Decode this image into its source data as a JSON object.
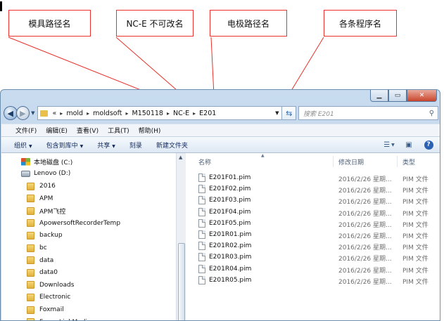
{
  "callouts": {
    "mold_path": "模具路径名",
    "nce_fixed": "NC-E 不可改名",
    "electrode_path": "电极路径名",
    "program_names": "各条程序名"
  },
  "address": {
    "prefix": "«",
    "crumbs": [
      "mold",
      "moldsoft",
      "M150118",
      "NC-E",
      "E201"
    ]
  },
  "search": {
    "placeholder": "搜索 E201",
    "icon": "search-icon"
  },
  "window_buttons": {
    "minimize": "minimize-icon",
    "maximize": "maximize-icon",
    "close": "close-icon"
  },
  "menu": {
    "file": "文件(F)",
    "edit": "编辑(E)",
    "view": "查看(V)",
    "tools": "工具(T)",
    "help": "帮助(H)"
  },
  "toolbar": {
    "organize": "组织",
    "include_library": "包含到库中",
    "share": "共享",
    "burn": "刻录",
    "new_folder": "新建文件夹"
  },
  "nav_tree": {
    "drive_c": "本地磁盘 (C:)",
    "drive_d": "Lenovo (D:)",
    "folders": [
      "2016",
      "APM",
      "APM飞控",
      "ApowersoftRecorderTemp",
      "backup",
      "bc",
      "data",
      "data0",
      "Downloads",
      "Electronic",
      "Foxmail",
      "FrameLinkMedia"
    ]
  },
  "columns": {
    "name": "名称",
    "modified": "修改日期",
    "type": "类型"
  },
  "files": [
    {
      "name": "E201F01.pim",
      "date": "2016/2/26 星期...",
      "type": "PIM 文件"
    },
    {
      "name": "E201F02.pim",
      "date": "2016/2/26 星期...",
      "type": "PIM 文件"
    },
    {
      "name": "E201F03.pim",
      "date": "2016/2/26 星期...",
      "type": "PIM 文件"
    },
    {
      "name": "E201F04.pim",
      "date": "2016/2/26 星期...",
      "type": "PIM 文件"
    },
    {
      "name": "E201F05.pim",
      "date": "2016/2/26 星期...",
      "type": "PIM 文件"
    },
    {
      "name": "E201R01.pim",
      "date": "2016/2/26 星期...",
      "type": "PIM 文件"
    },
    {
      "name": "E201R02.pim",
      "date": "2016/2/26 星期...",
      "type": "PIM 文件"
    },
    {
      "name": "E201R03.pim",
      "date": "2016/2/26 星期...",
      "type": "PIM 文件"
    },
    {
      "name": "E201R04.pim",
      "date": "2016/2/26 星期...",
      "type": "PIM 文件"
    },
    {
      "name": "E201R05.pim",
      "date": "2016/2/26 星期...",
      "type": "PIM 文件"
    }
  ],
  "colors": {
    "callout_line": "#e8322b",
    "window_frame": "#b9d0e8",
    "folder": "#e9c04a"
  }
}
